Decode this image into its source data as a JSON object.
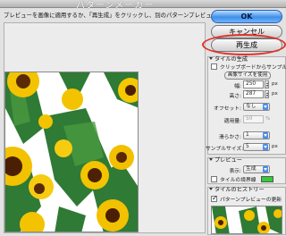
{
  "window": {
    "title": "パターンメーカー",
    "instruction": "プレビューを画像に適用するか、「再生成」をクリックし、別のパターンプレビューを作成します。"
  },
  "buttons": {
    "ok": "OK",
    "cancel": "キャンセル",
    "regenerate": "再生成"
  },
  "tile_generation": {
    "section": "タイルの生成",
    "use_clipboard": "クリップボードからサンプル",
    "use_image_size": "画像サイズを使用",
    "width_label": "幅:",
    "width_value": "250",
    "height_label": "高さ:",
    "height_value": "287",
    "unit": "px",
    "offset_label": "オフセット:",
    "offset_value": "なし",
    "amount_label": "適用量:",
    "amount_value": "50",
    "amount_unit": "%",
    "smoothness_label": "滑らかさ:",
    "smoothness_value": "1",
    "sample_size_label": "サンプルサイズ:",
    "sample_size_value": "5",
    "sample_unit": "px"
  },
  "preview_section": {
    "section": "プレビュー",
    "show_label": "表示:",
    "show_value": "生成",
    "tile_boundaries": "タイルの境界線",
    "boundary_color": "#33cc33"
  },
  "tile_history": {
    "section": "タイルのヒストリー",
    "update_preview": "パターンプレビューの更新"
  },
  "highlight_color": "#e0302a",
  "accent_color": "#3f8fe8"
}
